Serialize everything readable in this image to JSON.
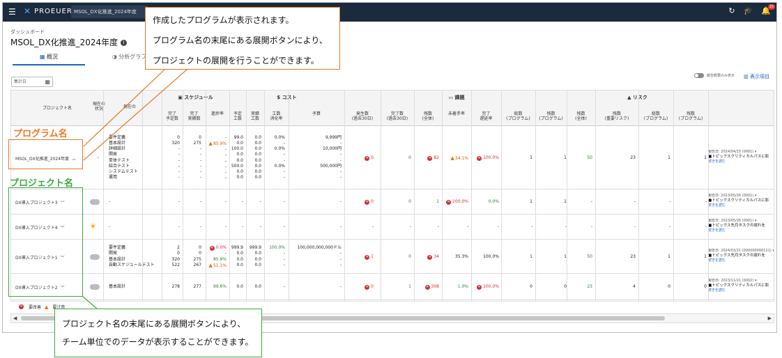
{
  "app": {
    "logo": "PROEUER",
    "tab": "MSOL_DX化推進_2024年度",
    "notif_count": "10"
  },
  "breadcrumb": "ダッシュボード",
  "title": "MSOL_DX化推進_2024年度",
  "tabs": [
    "概況",
    "分析グラフ"
  ],
  "filter": {
    "date_label": "集計日",
    "toggle_label": "報告概要のみ表示",
    "col_btn": "表示項目"
  },
  "headers": {
    "project": "プロジェクト名",
    "status": "現在の\n状況",
    "phase": "現在の",
    "schedule": "スケジュール",
    "cost": "コスト",
    "task": "課題",
    "risk": "リスク",
    "cols": [
      "完了\n予定数",
      "完了\n実績数",
      "進捗率",
      "予定\n工数",
      "実績\n工数",
      "工数\n消化率",
      "予算",
      "発生数\n(過去30日)",
      "完了数\n(過去30日)",
      "残数\n(全体)",
      "未着手率",
      "完了\n遅延率",
      "総数\n(プログラム)",
      "残数\n(プログラム)",
      "残数\n(全体)",
      "残数\n(重要リスク)",
      "総数\n(プログラム)",
      "残数\n(プログラム)"
    ]
  },
  "rows": [
    {
      "name": "MSOL_DX化推進_2024年度",
      "chev": "^",
      "status": "-",
      "phases": "要件定義\n基本設計\n詳細設計\n開発\n単体テスト\n結合テスト\nシステムテスト\n運用",
      "plan": "0\n320\n-\n-\n-\n-\n-\n-",
      "done": "0\n275\n-\n-\n-\n-\n-\n-",
      "prog": "-\n85.9%\n-\n-\n-\n-\n-\n-",
      "pe": "99.0\n0.0\n100.0\n0.0\n0.0\n500.0\n0.0\n0.0",
      "ae": "0.0\n0.0\n0.0\n0.0\n0.0\n0.0\n0.0\n0.0",
      "ec": "0.0%\n-\n0.0%\n-\n-\n0.0%\n-\n-",
      "bud": "9,999円\n-\n10,000円\n-\n-\n500,000円\n-\n-",
      "i_occ": "0",
      "i_done": "0",
      "i_rem": "82",
      "i_un": "34.1%",
      "i_del": "100.0%",
      "i_tot": "1",
      "i_prem": "1",
      "r_rem": "50",
      "r_imp": "23",
      "r_tot": "1",
      "r_prem": "1",
      "rep_date": "報告日: 2024/04/15 (0001) ▾",
      "rep_text": "■トピックスクリティカルパスに影",
      "rep_more": "続きを読む"
    },
    {
      "name": "DX導入プロジェクト3",
      "chev": "v",
      "phases": "-",
      "i_occ": "0",
      "i_done": "0",
      "i_rem": "1",
      "i_un": "100.0%",
      "i_del": "0.0%",
      "i_tot": "1",
      "i_prem": "1",
      "rep_date": "報告日: 2023/05/26 (0001) ▾",
      "rep_text": "■トピックスクリティカルパスに影",
      "rep_more": "続きを読む"
    },
    {
      "name": "DX導入プロジェクト4",
      "chev": "v",
      "phases": "-",
      "rep_date": "報告日: 2023/05/26 (0001) ▾",
      "rep_text": "■トピックス先月タスクの遅れを",
      "rep_more": "続きを読む"
    },
    {
      "name": "DX導入プロジェクト1",
      "chev": "v",
      "phases": "要件定義\n開発\n基本設計\n自動スケジュールテスト",
      "plan": "2\n0\n320\n522",
      "done": "0\n0\n275\n267",
      "prog": "0.0%\n-\n85.9%\n51.1%",
      "pe": "999.9\n0.0\n0.0\n0.0",
      "ae": "999.9\n0.0\n0.0\n0.0",
      "ec": "100.0%\n-\n-\n-",
      "bud": "100,000,000,000ドル\n-\n-\n-",
      "i_occ": "1",
      "i_done": "0",
      "i_rem": "34",
      "i_un": "35.3%",
      "i_del": "100.0%",
      "i_tot": "1",
      "i_prem": "1",
      "r_rem": "50",
      "r_imp": "23",
      "r_tot": "1",
      "r_prem": "1",
      "rep_date": "報告日: 2024/03/21 (000000000111) ▾",
      "rep_text": "■トピックス先月タスクの遅れを",
      "rep_more": "続きを読む"
    },
    {
      "name": "DX導入プロジェクト2",
      "chev": "v",
      "phases": "基本設計",
      "plan": "278",
      "done": "277",
      "prog": "99.6%",
      "pe": "0.0",
      "ae": "0.0",
      "ec": "-",
      "bud": "-",
      "i_occ": "0",
      "i_done": "1",
      "i_rem": "308",
      "i_un": "1.0%",
      "i_del": "100.0%",
      "i_tot": "0",
      "i_prem": "0",
      "r_rem": "23",
      "r_imp": "4",
      "r_tot": "0",
      "r_prem": "0",
      "rep_date": "報告日: 2023/11/21 (0002) ▾",
      "rep_text": "■トピックスクリティカルパスに影",
      "rep_more": "続きを読む"
    }
  ],
  "legend": {
    "bad": "要改善",
    "warn": "要注意"
  },
  "annotations": {
    "top": "作成したプログラムが表示されます。\nプログラム名の末尾にある展開ボタンにより、\nプロジェクトの展開を行うことができます。",
    "bottom": "プロジェクト名の末尾にある展開ボタンにより、\nチーム単位でのデータが表示することができます。",
    "program_label": "プログラム名",
    "project_label": "プロジェクト名"
  }
}
